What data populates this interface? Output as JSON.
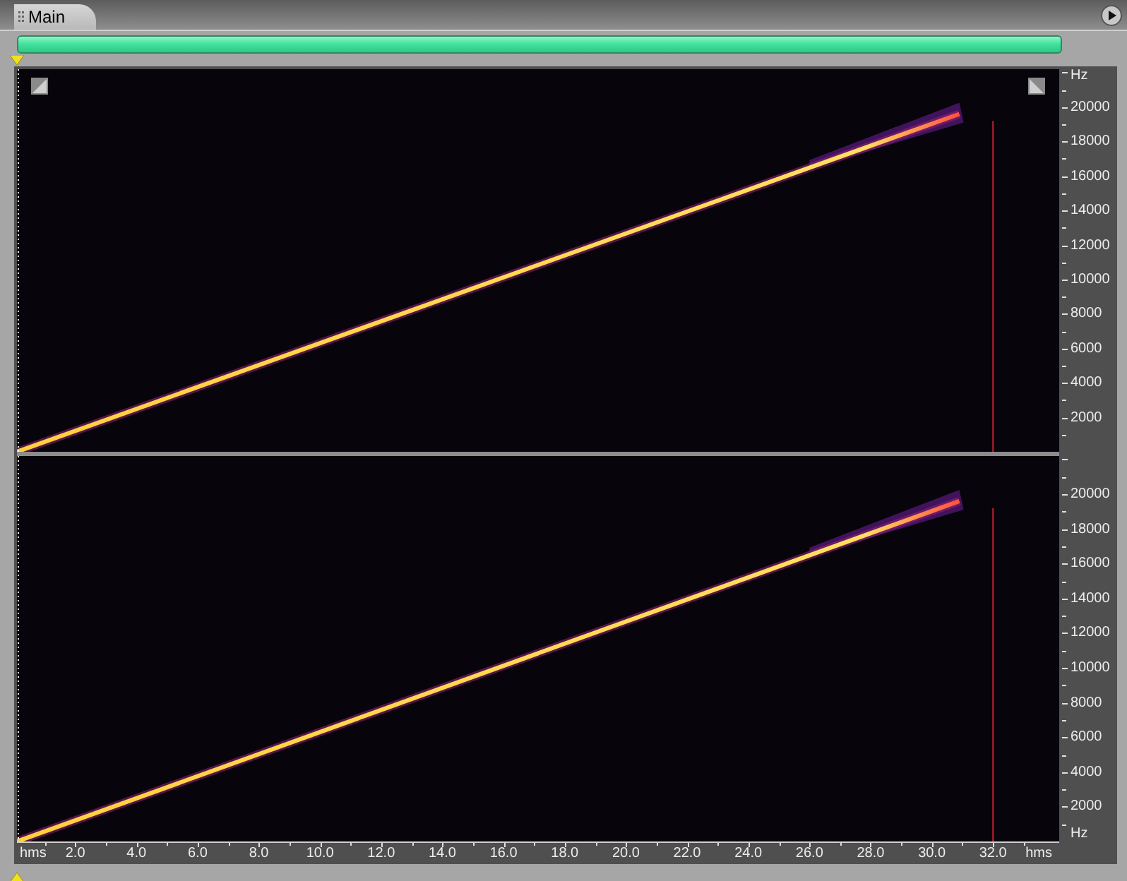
{
  "tab": {
    "label": "Main",
    "selected": true
  },
  "channels": [
    {
      "freq_axis": {
        "unit_top": "Hz",
        "ticks": [
          "20000",
          "18000",
          "16000",
          "14000",
          "12000",
          "10000",
          "8000",
          "6000",
          "4000",
          "2000"
        ]
      }
    },
    {
      "freq_axis": {
        "ticks": [
          "20000",
          "18000",
          "16000",
          "14000",
          "12000",
          "10000",
          "8000",
          "6000",
          "4000",
          "2000"
        ],
        "unit_bottom": "Hz"
      }
    }
  ],
  "time_axis": {
    "units": [
      "hms",
      "hms"
    ],
    "ticks": [
      "2.0",
      "4.0",
      "6.0",
      "8.0",
      "10.0",
      "12.0",
      "14.0",
      "16.0",
      "18.0",
      "20.0",
      "22.0",
      "24.0",
      "26.0",
      "28.0",
      "30.0",
      "32.0"
    ]
  }
}
